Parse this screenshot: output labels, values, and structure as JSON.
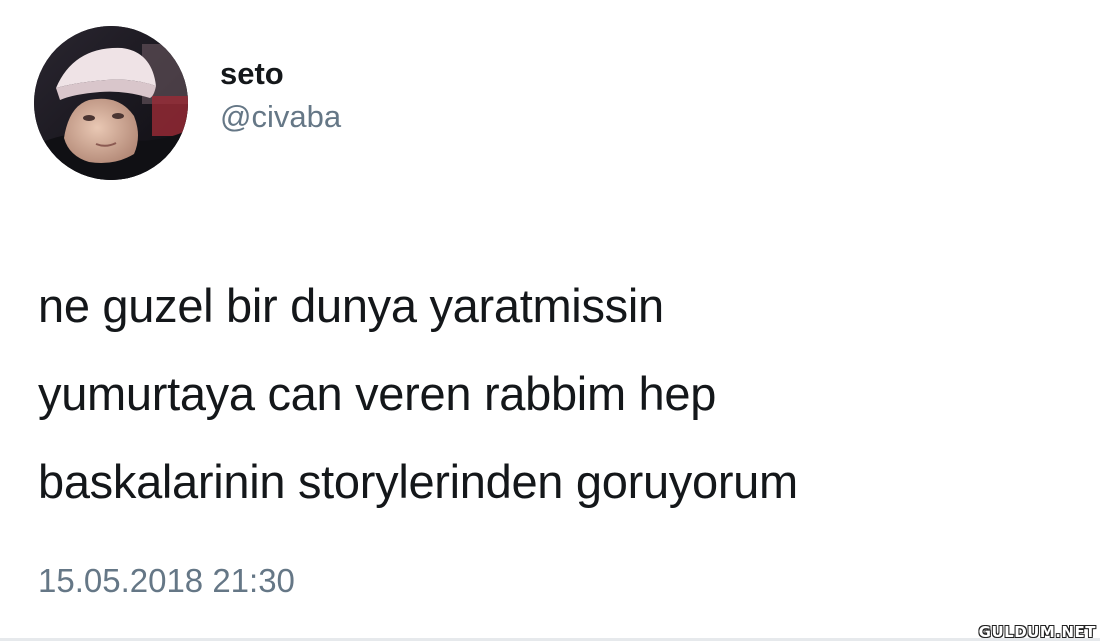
{
  "tweet": {
    "display_name": "seto",
    "handle": "@civaba",
    "avatar_icon": "profile-photo",
    "text_lines": [
      "ne guzel bir dunya yaratmissin",
      "yumurtaya can veren rabbim hep",
      "baskalarinin storylerinden goruyorum"
    ],
    "timestamp": "15.05.2018 21:30"
  },
  "watermark": {
    "text": "GULDUM.NET"
  }
}
